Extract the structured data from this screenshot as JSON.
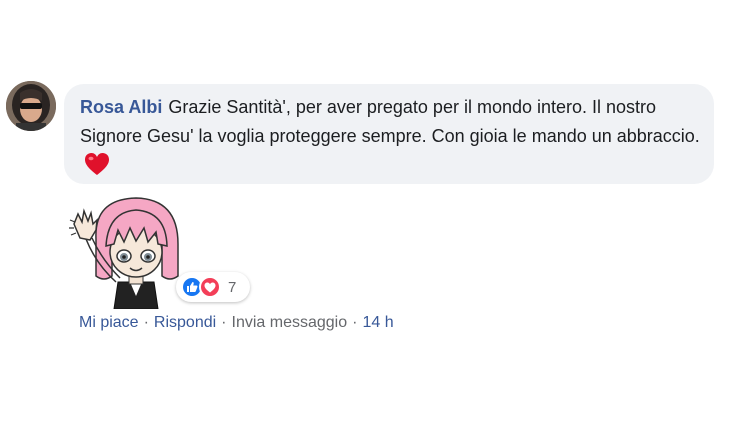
{
  "comment": {
    "author": "Rosa Albi",
    "text": "Grazie Santità', per aver pregato per il mondo intero. Il nostro Signore Gesu' la voglia proteggere sempre. Con gioia le mando un abbraccio.",
    "emoji": "heart-emoji",
    "author_color": "#385898",
    "bubble_color": "#f0f2f5"
  },
  "sticker": {
    "icon": "waving-girl-sticker"
  },
  "reactions": {
    "types": [
      "like",
      "love"
    ],
    "count": "7",
    "like_color": "#1877f2",
    "love_color": "#f33e58"
  },
  "actions": {
    "like": "Mi piace",
    "reply": "Rispondi",
    "message": "Invia messaggio",
    "separator": "·",
    "time": "14 h"
  }
}
